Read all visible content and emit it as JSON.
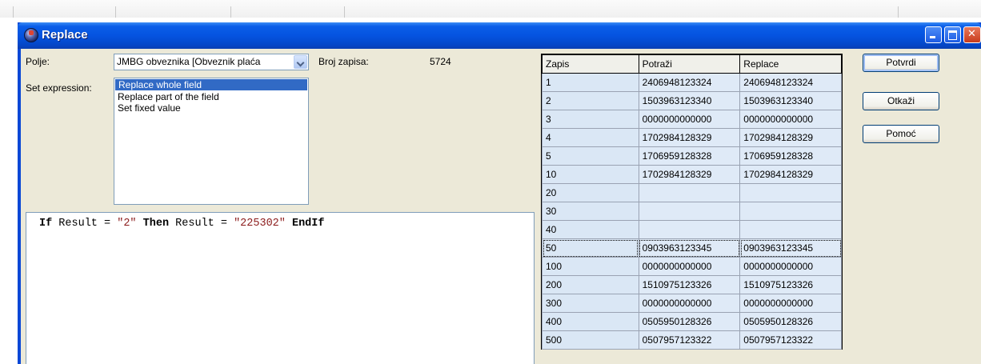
{
  "window": {
    "title": "Replace"
  },
  "form": {
    "polje_label": "Polje:",
    "polje_value": "JMBG obveznika [Obveznik plaća",
    "broj_label": "Broj zapisa:",
    "broj_value": "5724",
    "set_expr_label": "Set expression:",
    "options": [
      "Replace whole field",
      "Replace part of the field",
      "Set fixed value"
    ],
    "selected_option": "Replace whole field"
  },
  "editor": {
    "tokens": [
      {
        "t": "If",
        "cls": "kw"
      },
      {
        "t": " Result = ",
        "cls": ""
      },
      {
        "t": "\"2\"",
        "cls": "str"
      },
      {
        "t": " ",
        "cls": ""
      },
      {
        "t": "Then",
        "cls": "kw"
      },
      {
        "t": " Result = ",
        "cls": ""
      },
      {
        "t": "\"225302\"",
        "cls": "str"
      },
      {
        "t": " ",
        "cls": ""
      },
      {
        "t": "EndIf",
        "cls": "kw"
      }
    ]
  },
  "grid": {
    "headers": [
      "Zapis",
      "Potraži",
      "Replace"
    ],
    "rows": [
      [
        "1",
        "2406948123324",
        "2406948123324"
      ],
      [
        "2",
        "1503963123340",
        "1503963123340"
      ],
      [
        "3",
        "0000000000000",
        "0000000000000"
      ],
      [
        "4",
        "1702984128329",
        "1702984128329"
      ],
      [
        "5",
        "1706959128328",
        "1706959128328"
      ],
      [
        "10",
        "1702984128329",
        "1702984128329"
      ],
      [
        "20",
        "",
        ""
      ],
      [
        "30",
        "",
        ""
      ],
      [
        "40",
        "",
        ""
      ],
      [
        "50",
        "0903963123345",
        "0903963123345"
      ],
      [
        "100",
        "0000000000000",
        "0000000000000"
      ],
      [
        "200",
        "1510975123326",
        "1510975123326"
      ],
      [
        "300",
        "0000000000000",
        "0000000000000"
      ],
      [
        "400",
        "0505950128326",
        "0505950128326"
      ],
      [
        "500",
        "0507957123322",
        "0507957123322"
      ]
    ],
    "highlighted_row": "50"
  },
  "buttons": {
    "ok": "Potvrdi",
    "cancel": "Otkaži",
    "help": "Pomoć"
  }
}
